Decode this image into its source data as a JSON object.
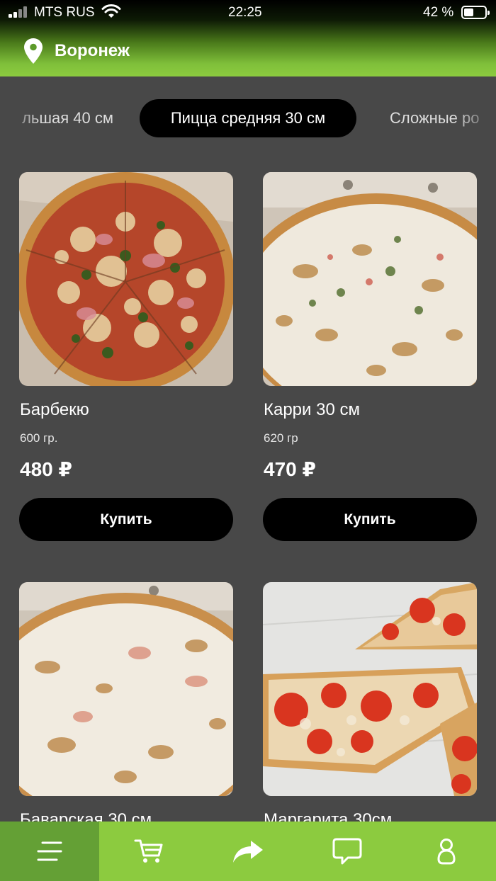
{
  "status_bar": {
    "carrier": "MTS RUS",
    "time": "22:25",
    "battery": "42 %"
  },
  "header": {
    "city": "Воронеж"
  },
  "categories": {
    "left_partial": "льшая 40 см",
    "active": "Пицца средняя 30 см",
    "right_partial": "Сложные ро"
  },
  "products": [
    {
      "name": "Барбекю",
      "weight": "600 гр.",
      "price": "480 ₽",
      "buy_label": "Купить"
    },
    {
      "name": "Карри 30 см",
      "weight": "620 гр",
      "price": "470 ₽",
      "buy_label": "Купить"
    },
    {
      "name": "Баварская 30 см"
    },
    {
      "name": "Маргарита 30см"
    }
  ],
  "bottom_nav": {
    "items": [
      "menu-icon",
      "cart-icon",
      "share-icon",
      "chat-icon",
      "profile-icon"
    ],
    "active": "menu-icon",
    "colors": {
      "bar": "#8ccb3f",
      "active": "#64a035"
    }
  }
}
